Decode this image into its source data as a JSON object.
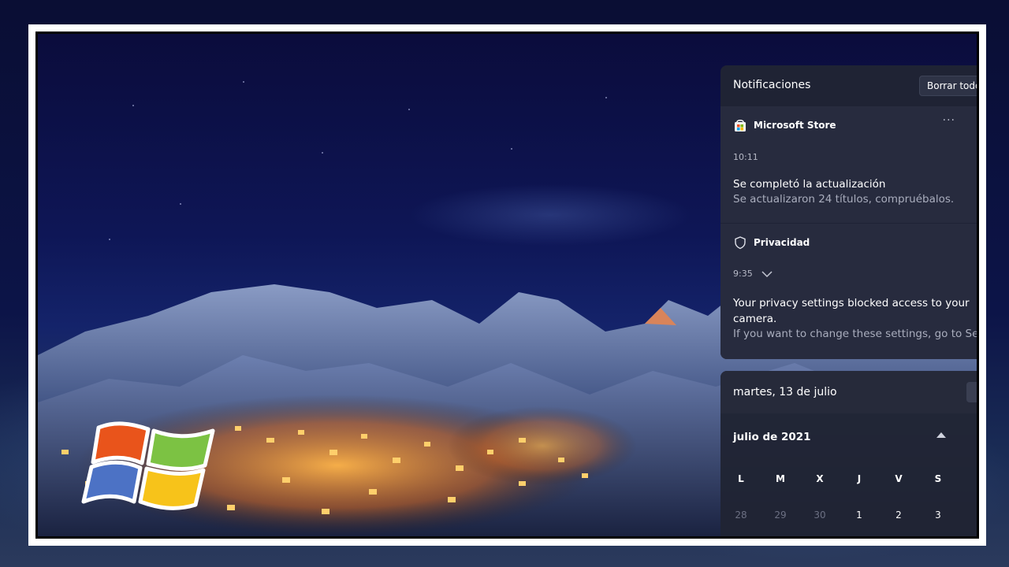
{
  "notifications": {
    "title": "Notificaciones",
    "clear_all": "Borrar todo",
    "items": [
      {
        "app": "Microsoft Store",
        "more": "···",
        "time": "10:11",
        "title": "Se completó la actualización",
        "body": "Se actualizaron 24 títulos, compruébalos."
      },
      {
        "app": "Privacidad",
        "time": "9:35",
        "title": "Your privacy settings blocked access to your camera.",
        "body": "If you want to change these settings, go to Sett"
      }
    ]
  },
  "calendar": {
    "date": "martes, 13 de julio",
    "month": "julio de 2021",
    "weekdays": [
      "L",
      "M",
      "X",
      "J",
      "V",
      "S"
    ],
    "days_prev": [
      "28",
      "29",
      "30"
    ],
    "days_current": [
      "1",
      "2",
      "3"
    ]
  },
  "colors": {
    "panel_bg": "#202434",
    "frame": "#ffffff",
    "windows_logo": [
      "#e9541b",
      "#7cc243",
      "#4c72c5",
      "#f7c31a"
    ]
  }
}
